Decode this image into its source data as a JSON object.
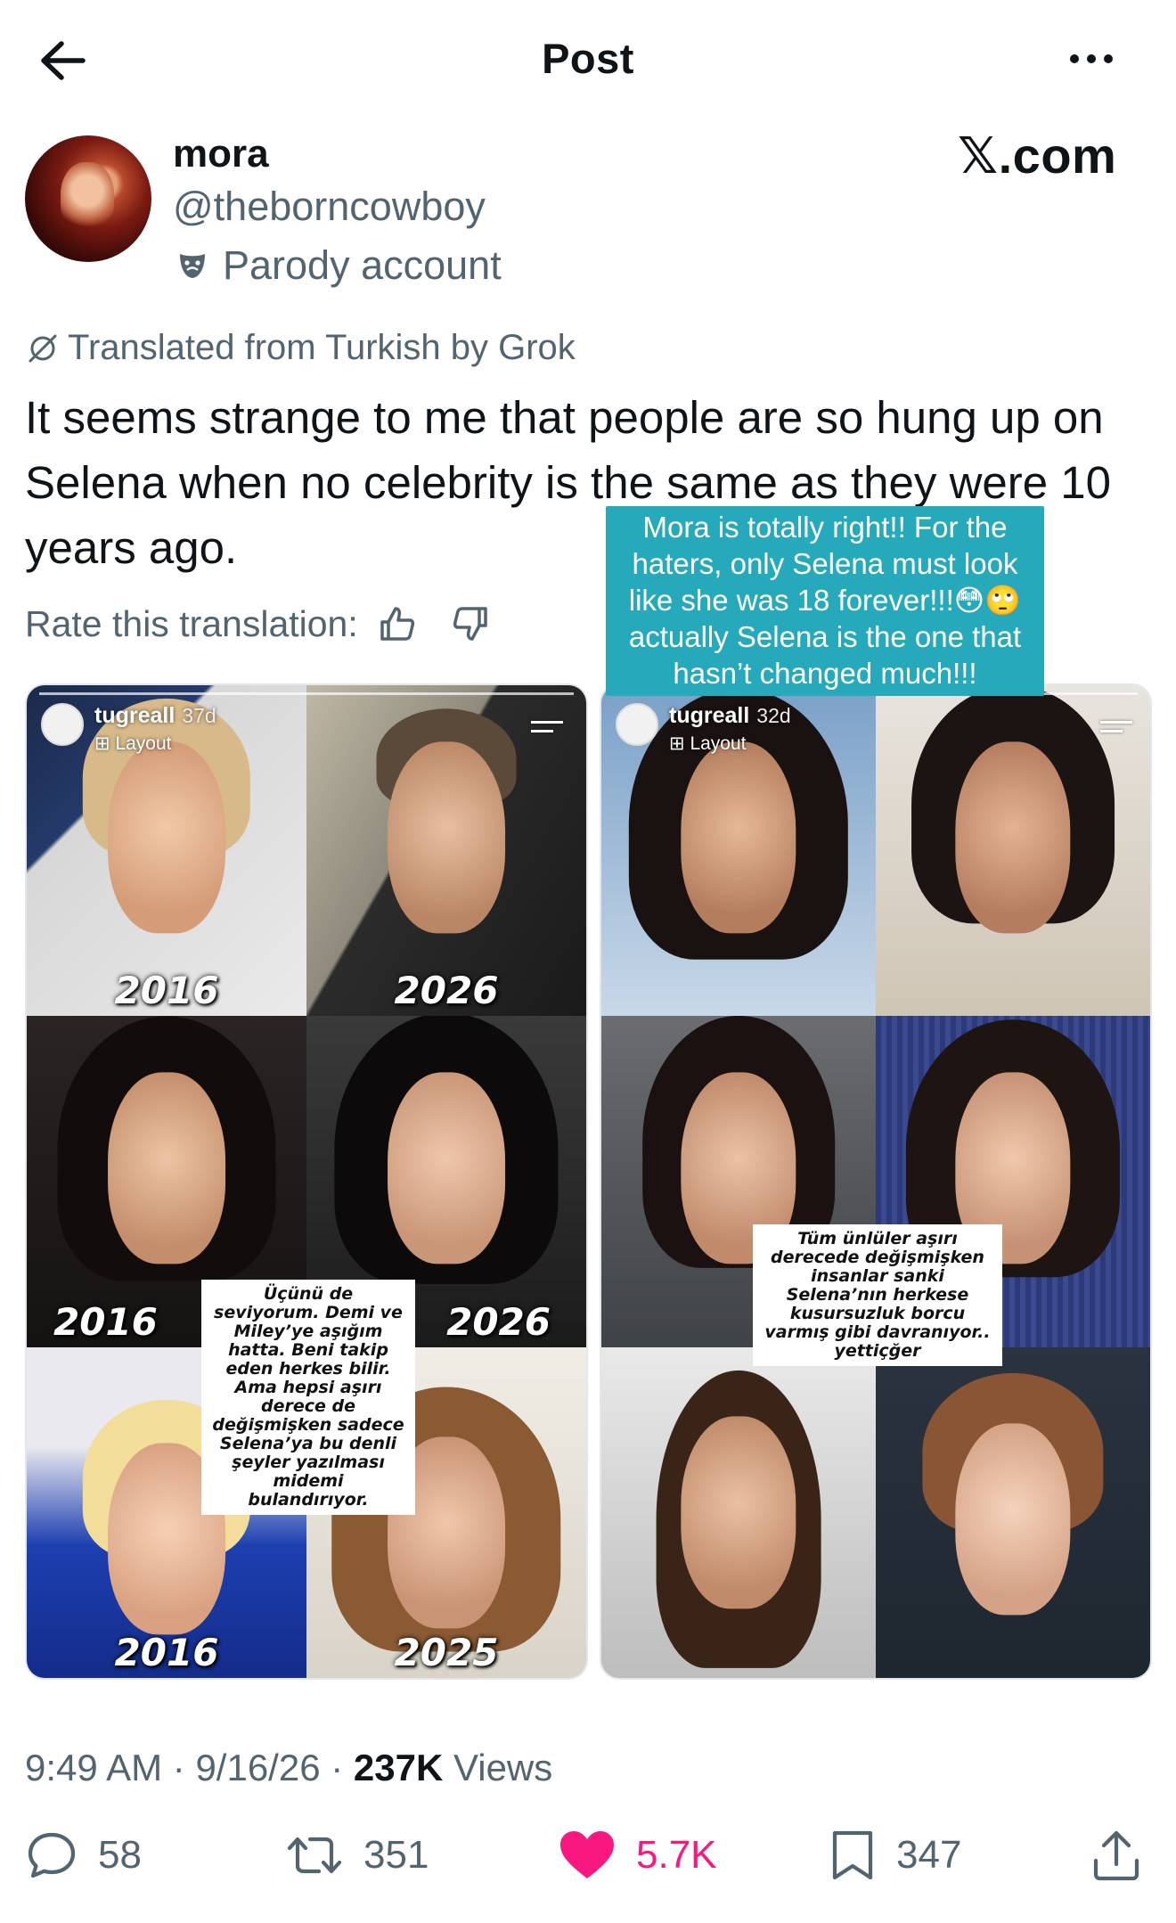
{
  "header": {
    "title": "Post"
  },
  "author": {
    "display_name": "mora",
    "handle": "@theborncowboy",
    "badge_label": "Parody account",
    "watermark": "𝕏.com"
  },
  "translation": {
    "label": "Translated from Turkish by Grok",
    "text": "It seems strange to me that people are so hung up on Selena when no celebrity is the same as they were 10 years ago.",
    "rate_label": "Rate this translation:"
  },
  "caption": {
    "text": "Mora is totally right!! For the haters, only Selena must look like she was 18 forever!!!😳🙄 actually Selena is the one that hasn’t changed much!!!"
  },
  "media": {
    "left": {
      "story_user": "tugreall",
      "story_age": "37d",
      "story_layout": "Layout",
      "years": [
        "2016",
        "2026",
        "2016",
        "2026",
        "2016",
        "2025"
      ],
      "note": "Üçünü de seviyorum. Demi ve Miley’ye aşığım hatta. Beni takip eden herkes bilir. Ama hepsi aşırı derece de değişmişken sadece Selena’ya bu denli şeyler yazılması midemi bulandırıyor."
    },
    "right": {
      "story_user": "tugreall",
      "story_age": "32d",
      "story_layout": "Layout",
      "note": "Tüm ünlüler aşırı derecede değişmişken insanlar sanki Selena’nın herkese kusursuzluk borcu varmış gibi davranıyor.. yettiçğer"
    }
  },
  "meta": {
    "time": "9:49 AM",
    "date": "9/16/26",
    "views_count": "237K",
    "views_label": "Views"
  },
  "actions": {
    "replies": "58",
    "reposts": "351",
    "likes": "5.7K",
    "bookmarks": "347"
  },
  "colors": {
    "text": "#0f1419",
    "secondary": "#536471",
    "like": "#f91880",
    "caption_bg": "#27a9bc"
  }
}
